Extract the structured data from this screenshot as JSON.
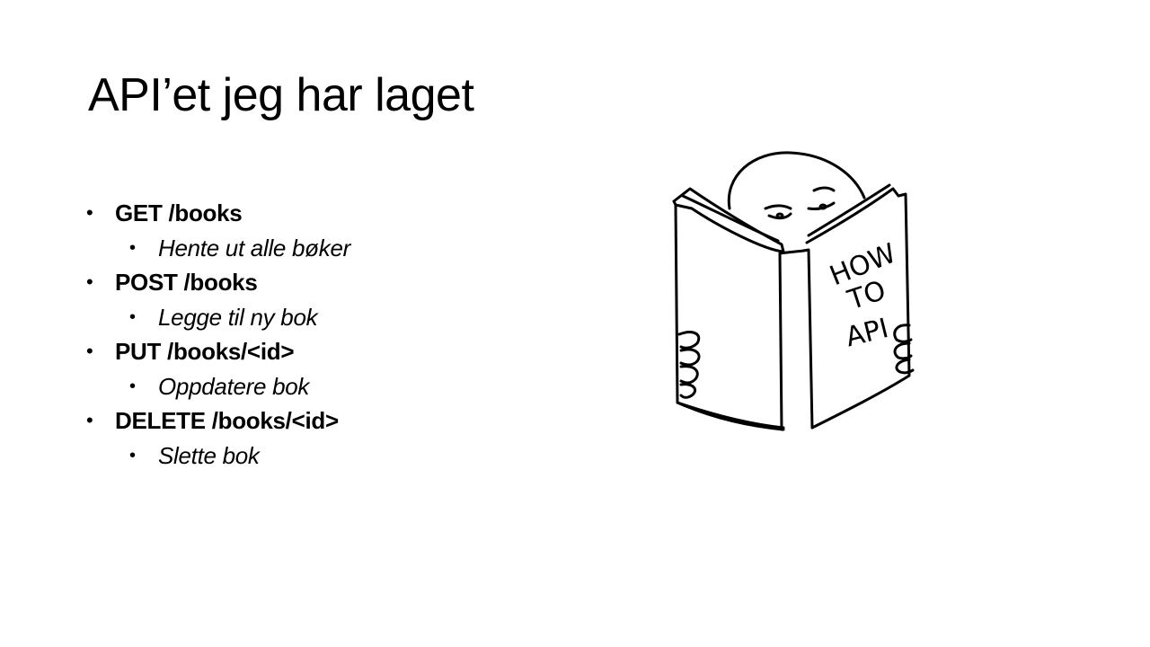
{
  "slide": {
    "title": "API’et jeg har laget",
    "bullets": [
      {
        "level": 1,
        "text": "GET /books"
      },
      {
        "level": 2,
        "text": "Hente ut alle bøker"
      },
      {
        "level": 1,
        "text": "POST /books"
      },
      {
        "level": 2,
        "text": "Legge til ny bok"
      },
      {
        "level": 1,
        "text": "PUT /books/<id>"
      },
      {
        "level": 2,
        "text": "Oppdatere bok"
      },
      {
        "level": 1,
        "text": "DELETE /books/<id>"
      },
      {
        "level": 2,
        "text": "Slette bok"
      }
    ],
    "bullet_symbol": "•",
    "illustration": {
      "book_cover_lines": [
        "HOW",
        "TO",
        "API"
      ]
    }
  }
}
